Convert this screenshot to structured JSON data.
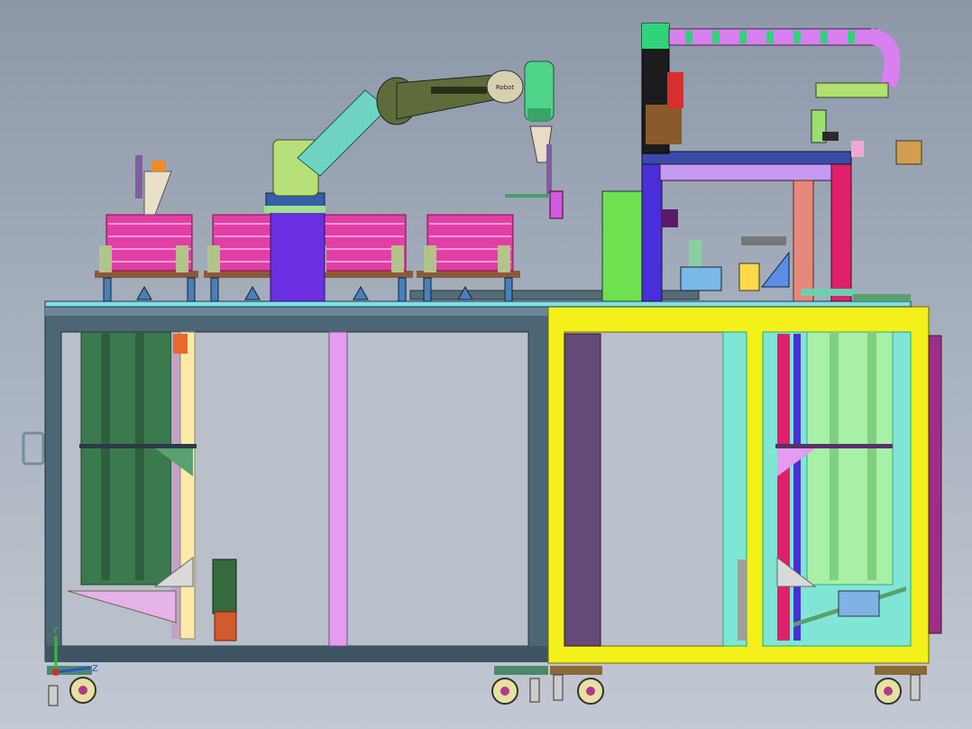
{
  "viewport": {
    "background_top": "#8c97a8",
    "background_bottom": "#c3c9d3"
  },
  "robot": {
    "brand_label": "Robot"
  },
  "triad": {
    "axis_y": "Y",
    "axis_z": "Z",
    "axis_y_color": "#2fbf2f",
    "axis_z_color": "#2f4fd0",
    "axis_x_color": "#d02f2f"
  },
  "colors": {
    "frame_left": "#48606f",
    "frame_right": "#f2ef10",
    "pink_rack": "#e23fa6",
    "robot_arm": "#6fd4c2",
    "robot_dark": "#5d6c3a",
    "gantry_blue": "#4a2fd8",
    "gantry_pink": "#e0206a",
    "cyan_panel": "#7fe6d6"
  }
}
